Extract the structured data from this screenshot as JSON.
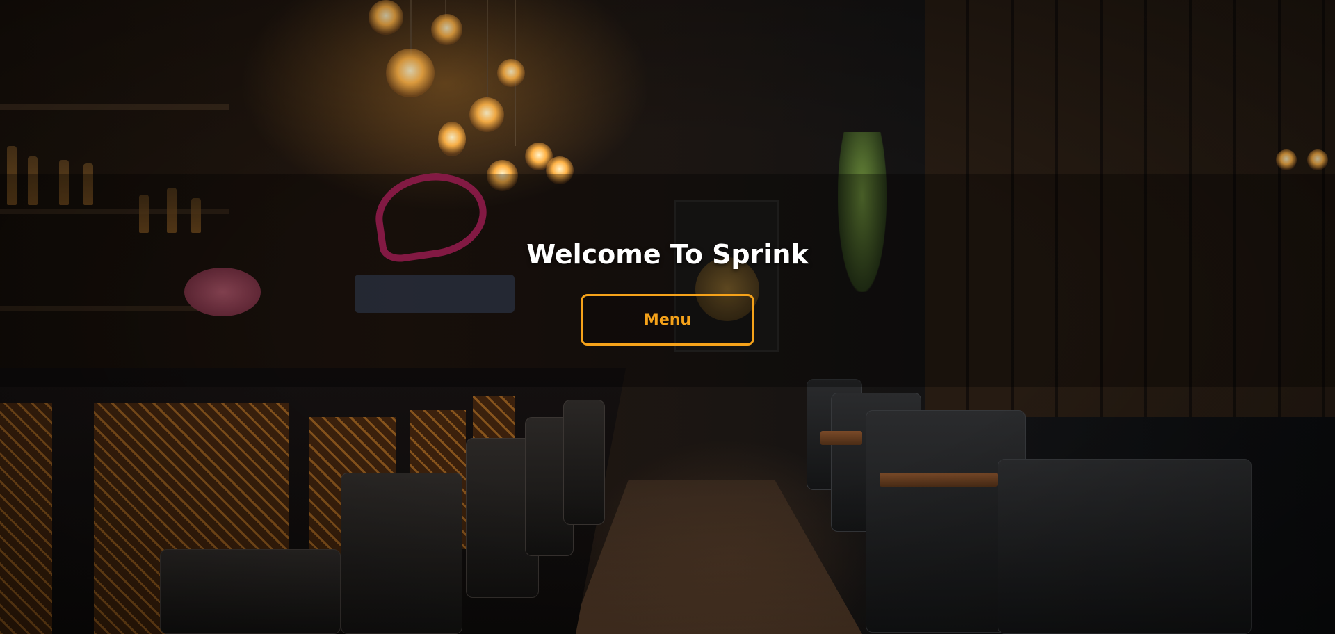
{
  "hero": {
    "title": "Welcome To Sprink",
    "menu_button_label": "Menu",
    "accent_color": "#f5a21a",
    "title_color": "#ffffff",
    "background_image": "restaurant-bar-interior-photo"
  }
}
